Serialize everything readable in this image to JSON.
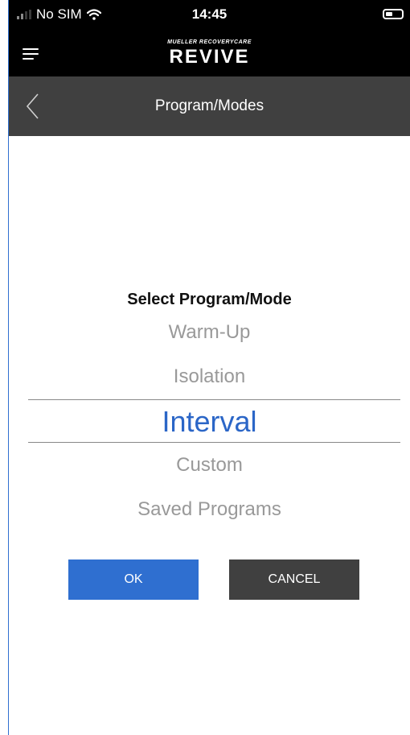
{
  "status_bar": {
    "carrier": "No SIM",
    "time": "14:45"
  },
  "header": {
    "brand_sub": "MUELLER RECOVERYCARE",
    "brand_main": "REVIVE"
  },
  "nav": {
    "title": "Program/Modes"
  },
  "picker": {
    "label": "Select Program/Mode",
    "options": [
      "Warm-Up",
      "Isolation",
      "Interval",
      "Custom",
      "Saved Programs"
    ],
    "selected": "Interval"
  },
  "buttons": {
    "ok": "OK",
    "cancel": "CANCEL"
  },
  "colors": {
    "accent": "#2f6fd0",
    "selected_text": "#2b66c7",
    "nav_bg": "#404040",
    "header_bg": "#000000"
  },
  "icons": [
    "signal-icon",
    "wifi-icon",
    "battery-icon",
    "menu-icon",
    "back-icon"
  ]
}
